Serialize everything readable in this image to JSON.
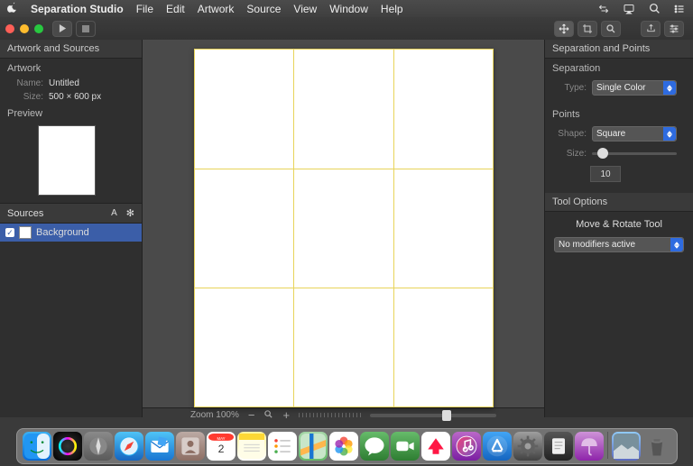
{
  "menubar": {
    "app": "Separation Studio",
    "items": [
      "File",
      "Edit",
      "Artwork",
      "Source",
      "View",
      "Window",
      "Help"
    ]
  },
  "toolbar": {
    "play": "▶",
    "stop": "■"
  },
  "left": {
    "panel_title": "Artwork and Sources",
    "artwork_head": "Artwork",
    "name_label": "Name:",
    "name_value": "Untitled",
    "size_label": "Size:",
    "size_value": "500 × 600 px",
    "preview_head": "Preview",
    "sources_head": "Sources",
    "letter": "A",
    "gear": "✻",
    "source0": "Background"
  },
  "center": {
    "zoom_label": "Zoom 100%",
    "minus": "−",
    "plus": "+",
    "mag": "⚲"
  },
  "right": {
    "panel_title": "Separation and Points",
    "separation_head": "Separation",
    "type_label": "Type:",
    "type_value": "Single Color",
    "points_head": "Points",
    "shape_label": "Shape:",
    "shape_value": "Square",
    "size_label": "Size:",
    "size_value": "10",
    "tool_options_head": "Tool Options",
    "tool_name": "Move & Rotate Tool",
    "modifiers": "No modifiers active"
  }
}
